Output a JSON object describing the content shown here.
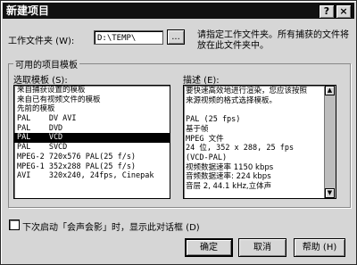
{
  "window": {
    "title": "新建项目"
  },
  "title_buttons": {
    "help": "?",
    "close": "×"
  },
  "folder": {
    "label": "工作文件夹 (W):",
    "value": "D:\\TEMP\\",
    "browse": "..."
  },
  "hint": {
    "line1": "请指定工作文件夹。所有捕获的文件将",
    "line2": "放在此文件夹中。"
  },
  "group": {
    "title": "可用的项目模板"
  },
  "templates": {
    "label": "选取模板 (S):",
    "items": [
      "来自捕获设置的模板",
      "来自已有视频文件的模板",
      "先前的模板",
      "PAL    DV AVI",
      "PAL    DVD",
      "PAL    VCD",
      "PAL    SVCD",
      "MPEG-2 720x576 PAL(25 f/s)",
      "MPEG-1 352x288 PAL(25 f/s)",
      "AVI    320x240, 24fps, Cinepak"
    ],
    "selected_index": 5
  },
  "description": {
    "label": "描述 (E):",
    "lines": [
      "要快速高效地进行渲染，您应该按照",
      "来源视频的格式选择模板。",
      "",
      "PAL (25 fps)",
      "基于帧",
      "MPEG 文件",
      "24 位, 352 x 288, 25 fps",
      "(VCD-PAL)",
      "视频数据速率 1150 kbps",
      "音频数据速率: 224 kbps",
      "音层 2, 44.1 kHz,立体声"
    ]
  },
  "checkbox": {
    "label": "下次启动「会声会影」时，显示此对话框 (D)",
    "checked": false
  },
  "buttons": {
    "ok": "确定",
    "cancel": "取消",
    "help": "帮助 (H)"
  }
}
